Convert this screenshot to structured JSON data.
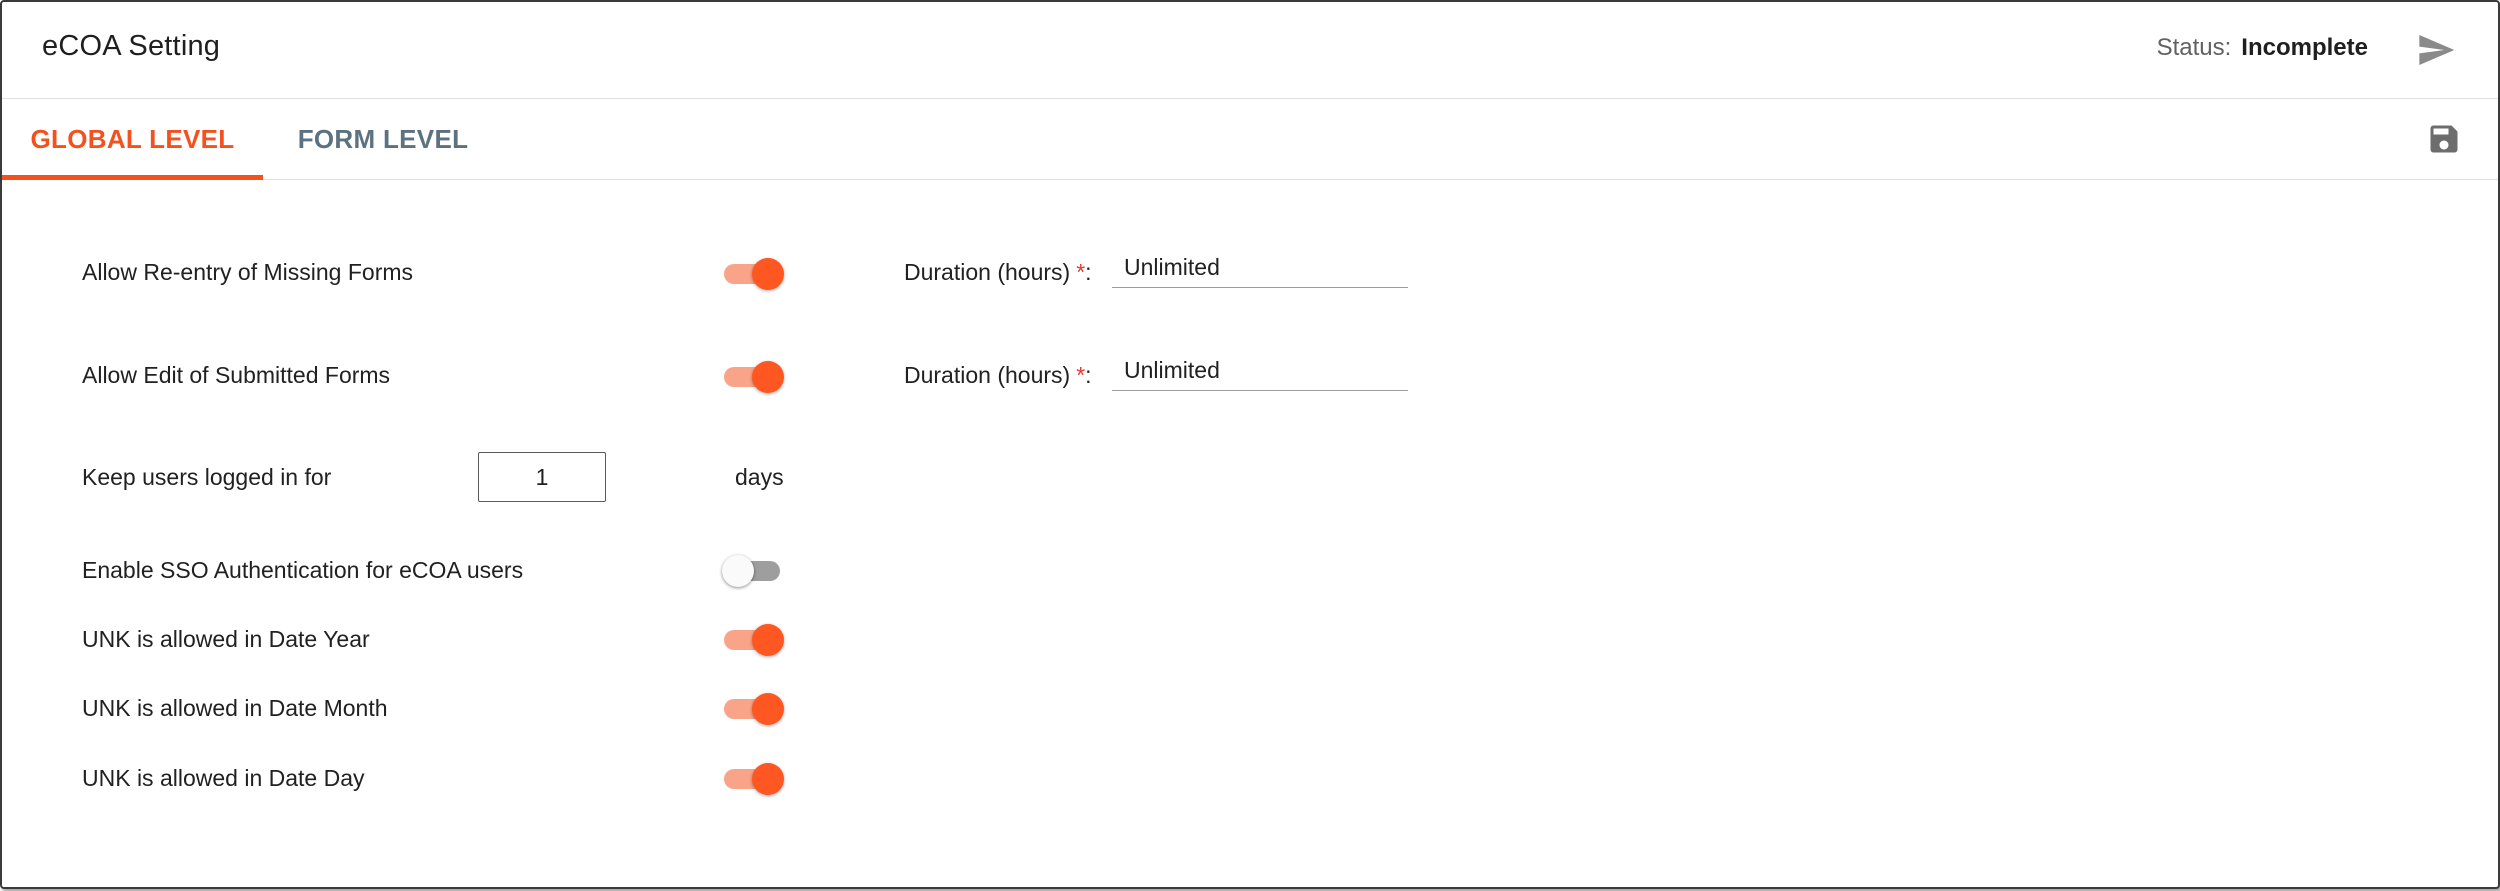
{
  "header": {
    "title": "eCOA Setting",
    "status_label": "Status:",
    "status_value": "Incomplete",
    "send_icon": "send-icon"
  },
  "tabs": [
    {
      "label": "GLOBAL LEVEL",
      "active": true
    },
    {
      "label": "FORM LEVEL",
      "active": false
    }
  ],
  "toolbar": {
    "save_icon": "save-icon"
  },
  "settings": {
    "reentry": {
      "label": "Allow Re-entry of Missing Forms",
      "enabled": true,
      "duration_label": "Duration (hours)",
      "required_mark": "*",
      "duration_suffix": ":",
      "duration_value": "Unlimited"
    },
    "edit": {
      "label": "Allow Edit of Submitted Forms",
      "enabled": true,
      "duration_label": "Duration (hours)",
      "required_mark": "*",
      "duration_suffix": ":",
      "duration_value": "Unlimited"
    },
    "keep_logged_in": {
      "label": "Keep users logged in for",
      "value": "1",
      "unit": "days"
    },
    "sso": {
      "label": "Enable SSO Authentication for eCOA users",
      "enabled": false
    },
    "unk_year": {
      "label": "UNK is allowed in Date Year",
      "enabled": true
    },
    "unk_month": {
      "label": "UNK is allowed in Date Month",
      "enabled": true
    },
    "unk_day": {
      "label": "UNK is allowed in Date Day",
      "enabled": true
    }
  },
  "colors": {
    "accent": "#ff5722",
    "accent_light": "#f9a489",
    "tab_inactive": "#5d7280",
    "required": "#e53935"
  }
}
